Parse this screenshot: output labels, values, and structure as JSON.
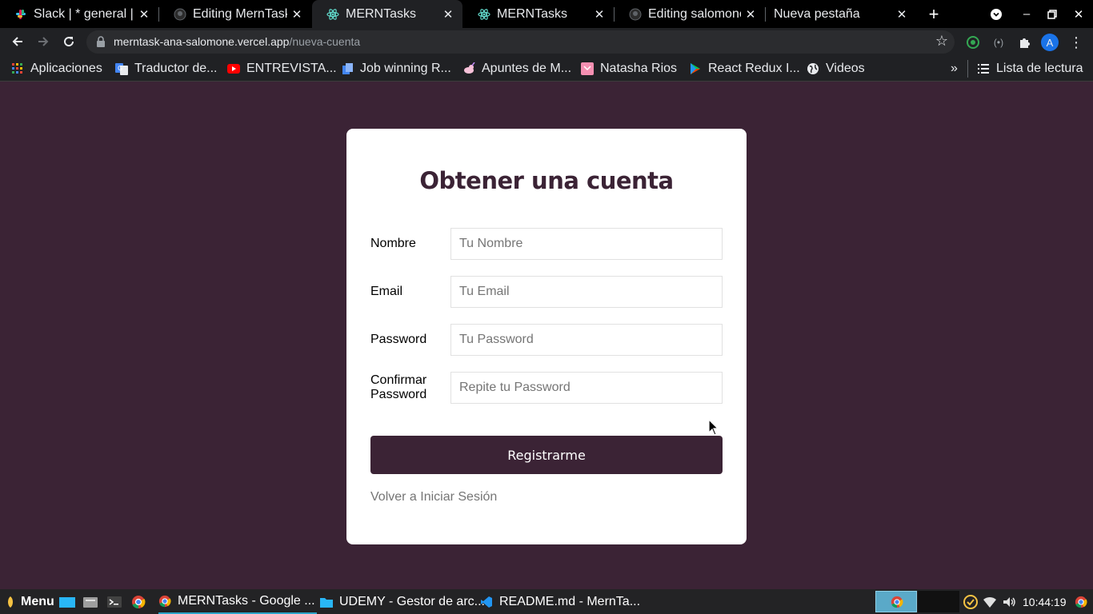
{
  "browser": {
    "tabs": [
      {
        "title": "Slack | * general |",
        "icon": "slack-icon",
        "active": false
      },
      {
        "title": "Editing MernTask",
        "icon": "github-icon",
        "active": false
      },
      {
        "title": "MERNTasks",
        "icon": "react-icon",
        "active": true
      },
      {
        "title": "MERNTasks",
        "icon": "react-icon",
        "active": false
      },
      {
        "title": "Editing salomone",
        "icon": "github-icon",
        "active": false
      },
      {
        "title": "Nueva pestaña",
        "icon": "",
        "active": false
      }
    ],
    "url_host": "merntask-ana-salomone.vercel.app",
    "url_path": "/nueva-cuenta",
    "profile_initial": "A",
    "bookmarks": [
      {
        "label": "Aplicaciones",
        "icon": "apps-grid-icon"
      },
      {
        "label": "Traductor de...",
        "icon": "google-translate-icon"
      },
      {
        "label": "ENTREVISTA...",
        "icon": "youtube-icon"
      },
      {
        "label": "Job winning R...",
        "icon": "document-icon"
      },
      {
        "label": "Apuntes de M...",
        "icon": "unicorn-icon"
      },
      {
        "label": "Natasha Rios",
        "icon": "pink-square-icon"
      },
      {
        "label": "React Redux I...",
        "icon": "play-icon"
      },
      {
        "label": "Videos",
        "icon": "globe-icon"
      }
    ],
    "reading_list": "Lista de lectura"
  },
  "page": {
    "title": "Obtener una cuenta",
    "fields": [
      {
        "label": "Nombre",
        "placeholder": "Tu Nombre",
        "value": ""
      },
      {
        "label": "Email",
        "placeholder": "Tu Email",
        "value": ""
      },
      {
        "label": "Password",
        "placeholder": "Tu Password",
        "value": ""
      },
      {
        "label": "Confirmar Password",
        "placeholder": "Repite tu Password",
        "value": ""
      }
    ],
    "submit_label": "Registrarme",
    "back_link": "Volver a Iniciar Sesión"
  },
  "taskbar": {
    "menu_label": "Menu",
    "windows": [
      {
        "label": "MERNTasks - Google ...",
        "icon": "chrome-icon",
        "active": true
      },
      {
        "label": "UDEMY - Gestor de arc...",
        "icon": "folder-icon",
        "active": false
      },
      {
        "label": "README.md - MernTa...",
        "icon": "vscode-icon",
        "active": false
      }
    ],
    "clock": "10:44:19"
  },
  "colors": {
    "page_background": "#3b2335",
    "primary": "#3b2335",
    "card": "#ffffff",
    "link": "#757575"
  }
}
